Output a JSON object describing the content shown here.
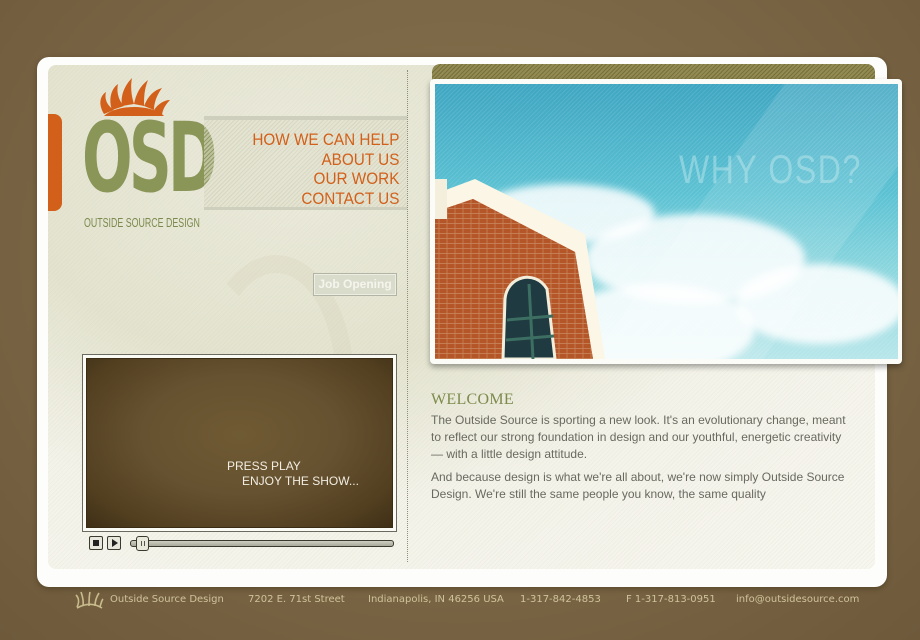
{
  "brand": {
    "logo_letters": "OSD",
    "logo_subtitle": "OUTSIDE SOURCE DESIGN",
    "accent_color": "#d2601a",
    "logo_color": "#8a9558"
  },
  "nav": {
    "items": [
      {
        "label": "HOW WE CAN HELP"
      },
      {
        "label": "ABOUT US"
      },
      {
        "label": "OUR WORK"
      },
      {
        "label": "CONTACT US"
      }
    ]
  },
  "job_button": {
    "label": "Job Opening"
  },
  "video": {
    "line1": "PRESS PLAY",
    "line2": "ENJOY THE SHOW...",
    "progress_percent": 2
  },
  "hero": {
    "overlay_text": "WHY OSD?"
  },
  "welcome": {
    "title": "WELCOME",
    "paragraphs": [
      "The Outside Source is sporting a new look. It's an evolutionary change, meant to reflect our strong foundation in design and our youthful, energetic creativity — with a little design attitude.",
      "And because design is what we're all about, we're now simply Outside Source Design. We're still the same people you know, the same quality"
    ]
  },
  "footer": {
    "company": "Outside Source Design",
    "street": "7202 E. 71st Street",
    "city": "Indianapolis, IN 46256 USA",
    "phone": "1-317-842-4853",
    "fax": "F 1-317-813-0951",
    "email": "info@outsidesource.com"
  }
}
